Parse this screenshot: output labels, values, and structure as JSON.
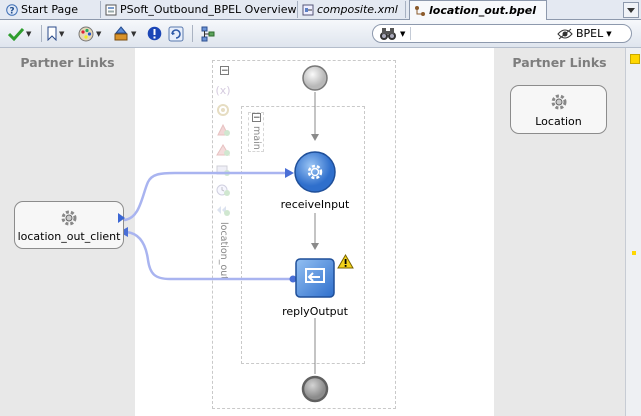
{
  "tabs": [
    {
      "label": "Start Page",
      "icon": "help-icon",
      "active": false
    },
    {
      "label": "PSoft_Outbound_BPEL Overview",
      "icon": "project-icon",
      "active": false
    },
    {
      "label": "composite.xml",
      "icon": "composite-icon",
      "active": false
    },
    {
      "label": "location_out.bpel",
      "icon": "bpel-process-icon",
      "active": true
    }
  ],
  "toolbar": {
    "bpel_label": "BPEL",
    "search_placeholder": ""
  },
  "canvas": {
    "left_partner_header": "Partner Links",
    "right_partner_header": "Partner Links",
    "left_partner_link": "location_out_client",
    "right_partner_link": "Location",
    "scope_label": "main",
    "process_label": "location_out",
    "activities": [
      {
        "label": "receiveInput",
        "type": "receive"
      },
      {
        "label": "replyOutput",
        "type": "reply",
        "warning": true
      }
    ]
  },
  "colors": {
    "tab_bar": "#e4e9f2",
    "partner_panel": "#e8e8e8",
    "connector": "#a9b4f0",
    "activity_blue": "#4a8ee0",
    "warning_yellow": "#f2d21a"
  }
}
